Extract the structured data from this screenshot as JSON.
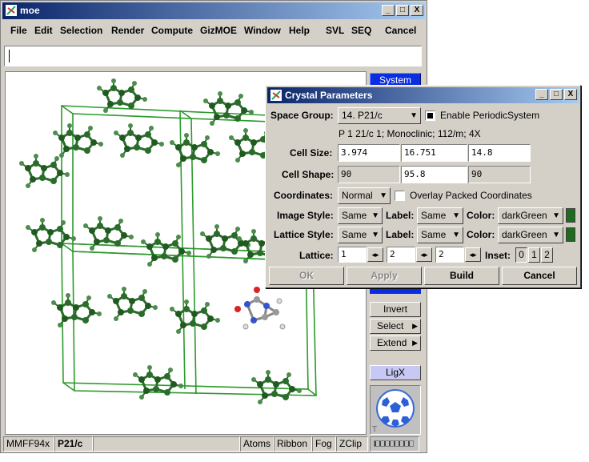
{
  "main_window": {
    "title": "moe",
    "controls": [
      "_",
      "□",
      "X"
    ],
    "menus": [
      "File",
      "Edit",
      "Selection",
      "Render",
      "Compute",
      "GizMOE",
      "Window",
      "Help",
      "SVL",
      "SEQ",
      "Cancel"
    ],
    "command_value": ""
  },
  "sidepanel": {
    "system_label": "System",
    "invert_label": "Invert",
    "select_label": "Select",
    "extend_label": "Extend",
    "ligx_label": "LigX",
    "arrow": "▶",
    "corner_letter": "T"
  },
  "status": {
    "forcefield": "MMFF94x",
    "spacegroup": "P21/c",
    "atoms": "Atoms",
    "ribbon": "Ribbon",
    "fog": "Fog",
    "zclip": "ZClip"
  },
  "dialog": {
    "title": "Crystal Parameters",
    "controls": [
      "_",
      "□",
      "X"
    ],
    "space_group_label": "Space Group:",
    "space_group_value": "14. P21/c",
    "enable_periodic_label": "Enable PeriodicSystem",
    "enable_periodic_checked": true,
    "space_group_desc": "P 1 21/c 1; Monoclinic; 112/m; 4X",
    "cell_size_label": "Cell Size:",
    "cell_size": [
      "3.974",
      "16.751",
      "14.8"
    ],
    "cell_shape_label": "Cell Shape:",
    "cell_shape": [
      "90",
      "95.8",
      "90"
    ],
    "coordinates_label": "Coordinates:",
    "coordinates_value": "Normal",
    "overlay_label": "Overlay Packed Coordinates",
    "image_style_label": "Image Style:",
    "image_style_value": "Same",
    "image_label_label": "Label:",
    "image_label_value": "Same",
    "image_color_label": "Color:",
    "image_color_value": "darkGreen",
    "lattice_style_label": "Lattice Style:",
    "lattice_style_value": "Same",
    "lattice_label_label": "Label:",
    "lattice_label_value": "Same",
    "lattice_color_label": "Color:",
    "lattice_color_value": "darkGreen",
    "lattice_label": "Lattice:",
    "lattice_values": [
      "1",
      "2",
      "2"
    ],
    "spin_glyph": "◂▸",
    "inset_label": "Inset:",
    "inset_options": [
      "0",
      "1",
      "2"
    ],
    "ok_label": "OK",
    "apply_label": "Apply",
    "build_label": "Build",
    "cancel_label": "Cancel",
    "swatch_color": "#1f6a1f"
  }
}
